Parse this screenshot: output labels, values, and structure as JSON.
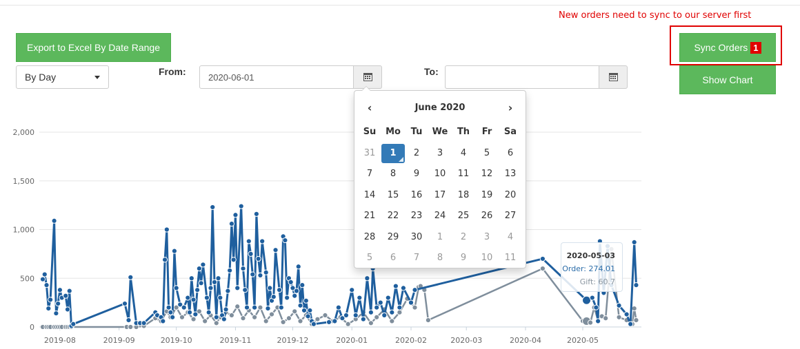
{
  "notice": "New orders need to sync to our server first",
  "buttons": {
    "export": "Export to Excel By Date Range",
    "sync": "Sync Orders",
    "sync_badge": "1",
    "show_chart": "Show Chart"
  },
  "filters": {
    "period": "By Day",
    "from_label": "From:",
    "from_value": "2020-06-01",
    "to_label": "To:",
    "to_value": ""
  },
  "datepicker": {
    "prev": "‹",
    "next": "›",
    "title": "June 2020",
    "dow": [
      "Su",
      "Mo",
      "Tu",
      "We",
      "Th",
      "Fr",
      "Sa"
    ],
    "weeks": [
      [
        "31",
        "1",
        "2",
        "3",
        "4",
        "5",
        "6"
      ],
      [
        "7",
        "8",
        "9",
        "10",
        "11",
        "12",
        "13"
      ],
      [
        "14",
        "15",
        "16",
        "17",
        "18",
        "19",
        "20"
      ],
      [
        "21",
        "22",
        "23",
        "24",
        "25",
        "26",
        "27"
      ],
      [
        "28",
        "29",
        "30",
        "1",
        "2",
        "3",
        "4"
      ],
      [
        "5",
        "6",
        "7",
        "8",
        "9",
        "10",
        "11"
      ]
    ],
    "selected": "1"
  },
  "tooltip": {
    "date": "2020-05-03",
    "order": "Order: 274.01",
    "gift": "Gift: 60.7"
  },
  "colors": {
    "accent_green": "#5cb85c",
    "alert_red": "#e00000",
    "order_series": "#1f5f9e",
    "gift_series": "#7f8e9c"
  },
  "chart_data": {
    "type": "line",
    "title": "",
    "xlabel": "",
    "ylabel": "",
    "ylim": [
      0,
      2000
    ],
    "y_ticks": [
      "0",
      "500",
      "1,000",
      "1,500",
      "2,000"
    ],
    "x_ticks": [
      "2019-08",
      "2019-09",
      "2019-10",
      "2019-11",
      "2019-12",
      "2020-01",
      "2020-02",
      "2020-03",
      "2020-04",
      "2020-05"
    ],
    "x_range": [
      "2019-07-23",
      "2020-05-31"
    ],
    "grid": true,
    "series": [
      {
        "key": "order",
        "points": [
          [
            "2019-07-23",
            490
          ],
          [
            "2019-07-24",
            540
          ],
          [
            "2019-07-25",
            430
          ],
          [
            "2019-07-26",
            190
          ],
          [
            "2019-07-27",
            280
          ],
          [
            "2019-07-29",
            1090
          ],
          [
            "2019-07-30",
            140
          ],
          [
            "2019-07-31",
            240
          ],
          [
            "2019-08-01",
            380
          ],
          [
            "2019-08-02",
            300
          ],
          [
            "2019-08-04",
            320
          ],
          [
            "2019-08-05",
            180
          ],
          [
            "2019-08-06",
            370
          ],
          [
            "2019-08-07",
            10
          ],
          [
            "2019-08-08",
            30
          ],
          [
            "2019-09-04",
            240
          ],
          [
            "2019-09-06",
            70
          ],
          [
            "2019-09-07",
            510
          ],
          [
            "2019-09-10",
            40
          ],
          [
            "2019-09-12",
            40
          ],
          [
            "2019-09-14",
            40
          ],
          [
            "2019-09-20",
            150
          ],
          [
            "2019-09-21",
            120
          ],
          [
            "2019-09-23",
            100
          ],
          [
            "2019-09-24",
            60
          ],
          [
            "2019-09-25",
            690
          ],
          [
            "2019-09-26",
            1000
          ],
          [
            "2019-09-27",
            200
          ],
          [
            "2019-09-28",
            150
          ],
          [
            "2019-09-29",
            100
          ],
          [
            "2019-09-30",
            780
          ],
          [
            "2019-10-01",
            400
          ],
          [
            "2019-10-03",
            230
          ],
          [
            "2019-10-05",
            200
          ],
          [
            "2019-10-07",
            300
          ],
          [
            "2019-10-08",
            150
          ],
          [
            "2019-10-09",
            500
          ],
          [
            "2019-10-10",
            280
          ],
          [
            "2019-10-11",
            130
          ],
          [
            "2019-10-12",
            380
          ],
          [
            "2019-10-13",
            600
          ],
          [
            "2019-10-14",
            450
          ],
          [
            "2019-10-15",
            640
          ],
          [
            "2019-10-17",
            300
          ],
          [
            "2019-10-18",
            150
          ],
          [
            "2019-10-19",
            400
          ],
          [
            "2019-10-20",
            1230
          ],
          [
            "2019-10-21",
            460
          ],
          [
            "2019-10-22",
            100
          ],
          [
            "2019-10-23",
            500
          ],
          [
            "2019-10-24",
            300
          ],
          [
            "2019-10-25",
            120
          ],
          [
            "2019-10-26",
            80
          ],
          [
            "2019-10-27",
            180
          ],
          [
            "2019-10-28",
            370
          ],
          [
            "2019-10-29",
            580
          ],
          [
            "2019-10-30",
            1060
          ],
          [
            "2019-10-31",
            690
          ],
          [
            "2019-11-01",
            1150
          ],
          [
            "2019-11-02",
            400
          ],
          [
            "2019-11-04",
            1240
          ],
          [
            "2019-11-05",
            600
          ],
          [
            "2019-11-06",
            380
          ],
          [
            "2019-11-07",
            200
          ],
          [
            "2019-11-08",
            880
          ],
          [
            "2019-11-09",
            750
          ],
          [
            "2019-11-10",
            540
          ],
          [
            "2019-11-11",
            200
          ],
          [
            "2019-11-12",
            1160
          ],
          [
            "2019-11-13",
            700
          ],
          [
            "2019-11-14",
            530
          ],
          [
            "2019-11-15",
            880
          ],
          [
            "2019-11-17",
            560
          ],
          [
            "2019-11-18",
            190
          ],
          [
            "2019-11-19",
            400
          ],
          [
            "2019-11-20",
            270
          ],
          [
            "2019-11-21",
            310
          ],
          [
            "2019-11-22",
            790
          ],
          [
            "2019-11-24",
            380
          ],
          [
            "2019-11-25",
            200
          ],
          [
            "2019-11-26",
            930
          ],
          [
            "2019-11-27",
            890
          ],
          [
            "2019-11-28",
            300
          ],
          [
            "2019-11-29",
            500
          ],
          [
            "2019-11-30",
            460
          ],
          [
            "2019-12-01",
            400
          ],
          [
            "2019-12-02",
            320
          ],
          [
            "2019-12-03",
            370
          ],
          [
            "2019-12-04",
            620
          ],
          [
            "2019-12-05",
            220
          ],
          [
            "2019-12-06",
            430
          ],
          [
            "2019-12-07",
            170
          ],
          [
            "2019-12-08",
            270
          ],
          [
            "2019-12-09",
            110
          ],
          [
            "2019-12-10",
            170
          ],
          [
            "2019-12-11",
            60
          ],
          [
            "2019-12-12",
            30
          ],
          [
            "2019-12-20",
            50
          ],
          [
            "2019-12-23",
            60
          ],
          [
            "2019-12-25",
            200
          ],
          [
            "2019-12-27",
            90
          ],
          [
            "2019-12-29",
            120
          ],
          [
            "2020-01-01",
            380
          ],
          [
            "2020-01-03",
            120
          ],
          [
            "2020-01-05",
            300
          ],
          [
            "2020-01-07",
            80
          ],
          [
            "2020-01-09",
            500
          ],
          [
            "2020-01-11",
            150
          ],
          [
            "2020-01-12",
            600
          ],
          [
            "2020-01-14",
            200
          ],
          [
            "2020-01-16",
            250
          ],
          [
            "2020-01-18",
            120
          ],
          [
            "2020-01-20",
            300
          ],
          [
            "2020-01-22",
            150
          ],
          [
            "2020-01-24",
            420
          ],
          [
            "2020-01-26",
            200
          ],
          [
            "2020-01-28",
            400
          ],
          [
            "2020-02-01",
            250
          ],
          [
            "2020-02-03",
            380
          ],
          [
            "2020-04-10",
            700
          ],
          [
            "2020-05-03",
            274
          ],
          [
            "2020-05-06",
            300
          ],
          [
            "2020-05-08",
            200
          ],
          [
            "2020-05-09",
            60
          ],
          [
            "2020-05-10",
            880
          ],
          [
            "2020-05-12",
            350
          ],
          [
            "2020-05-14",
            830
          ],
          [
            "2020-05-16",
            430
          ],
          [
            "2020-05-20",
            220
          ],
          [
            "2020-05-24",
            130
          ],
          [
            "2020-05-26",
            30
          ],
          [
            "2020-05-28",
            870
          ],
          [
            "2020-05-29",
            430
          ]
        ]
      },
      {
        "key": "gift",
        "points": [
          [
            "2019-07-23",
            0
          ],
          [
            "2019-07-25",
            0
          ],
          [
            "2019-07-26",
            0
          ],
          [
            "2019-07-27",
            0
          ],
          [
            "2019-07-29",
            0
          ],
          [
            "2019-07-30",
            0
          ],
          [
            "2019-07-31",
            0
          ],
          [
            "2019-08-01",
            0
          ],
          [
            "2019-08-02",
            0
          ],
          [
            "2019-08-04",
            0
          ],
          [
            "2019-08-05",
            0
          ],
          [
            "2019-08-06",
            0
          ],
          [
            "2019-08-07",
            0
          ],
          [
            "2019-09-05",
            0
          ],
          [
            "2019-09-07",
            0
          ],
          [
            "2019-09-10",
            0
          ],
          [
            "2019-09-14",
            10
          ],
          [
            "2019-09-20",
            90
          ],
          [
            "2019-09-23",
            60
          ],
          [
            "2019-09-26",
            160
          ],
          [
            "2019-09-28",
            100
          ],
          [
            "2019-10-01",
            200
          ],
          [
            "2019-10-04",
            100
          ],
          [
            "2019-10-07",
            150
          ],
          [
            "2019-10-10",
            80
          ],
          [
            "2019-10-13",
            160
          ],
          [
            "2019-10-16",
            60
          ],
          [
            "2019-10-19",
            120
          ],
          [
            "2019-10-22",
            40
          ],
          [
            "2019-10-24",
            100
          ],
          [
            "2019-10-27",
            150
          ],
          [
            "2019-10-30",
            120
          ],
          [
            "2019-11-02",
            210
          ],
          [
            "2019-11-05",
            90
          ],
          [
            "2019-11-08",
            170
          ],
          [
            "2019-11-11",
            100
          ],
          [
            "2019-11-14",
            200
          ],
          [
            "2019-11-17",
            60
          ],
          [
            "2019-11-20",
            130
          ],
          [
            "2019-11-23",
            200
          ],
          [
            "2019-11-26",
            50
          ],
          [
            "2019-11-29",
            90
          ],
          [
            "2019-12-02",
            160
          ],
          [
            "2019-12-05",
            60
          ],
          [
            "2019-12-08",
            120
          ],
          [
            "2019-12-11",
            30
          ],
          [
            "2019-12-14",
            80
          ],
          [
            "2019-12-18",
            120
          ],
          [
            "2019-12-22",
            60
          ],
          [
            "2019-12-26",
            100
          ],
          [
            "2019-12-30",
            30
          ],
          [
            "2020-01-03",
            80
          ],
          [
            "2020-01-07",
            150
          ],
          [
            "2020-01-11",
            40
          ],
          [
            "2020-01-14",
            100
          ],
          [
            "2020-01-18",
            180
          ],
          [
            "2020-01-22",
            60
          ],
          [
            "2020-01-26",
            150
          ],
          [
            "2020-01-30",
            290
          ],
          [
            "2020-02-03",
            200
          ],
          [
            "2020-02-05",
            410
          ],
          [
            "2020-02-06",
            420
          ],
          [
            "2020-02-08",
            380
          ],
          [
            "2020-02-10",
            70
          ],
          [
            "2020-04-10",
            600
          ],
          [
            "2020-05-01",
            61
          ],
          [
            "2020-05-03",
            60
          ],
          [
            "2020-05-05",
            45
          ],
          [
            "2020-05-07",
            200
          ],
          [
            "2020-05-09",
            70
          ],
          [
            "2020-05-11",
            110
          ],
          [
            "2020-05-13",
            90
          ],
          [
            "2020-05-16",
            800
          ],
          [
            "2020-05-20",
            100
          ],
          [
            "2020-05-24",
            70
          ],
          [
            "2020-05-27",
            30
          ],
          [
            "2020-05-28",
            190
          ],
          [
            "2020-05-29",
            70
          ]
        ]
      }
    ],
    "highlight": "2020-05-03"
  }
}
